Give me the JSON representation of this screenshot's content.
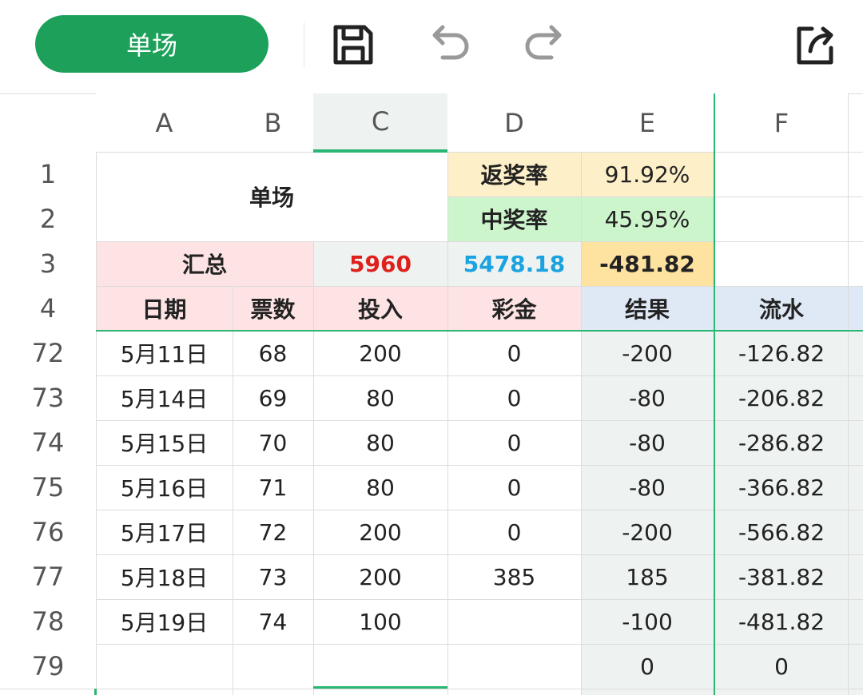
{
  "toolbar": {
    "sheet_name": "单场",
    "icons": [
      "save-icon",
      "undo-icon",
      "redo-icon",
      "share-icon"
    ]
  },
  "columns": [
    "A",
    "B",
    "C",
    "D",
    "E",
    "F"
  ],
  "rows_visible": [
    "1",
    "2",
    "3",
    "4",
    "72",
    "73",
    "74",
    "75",
    "76",
    "77",
    "78",
    "79"
  ],
  "summary": {
    "title": "单场",
    "return_rate_label": "返奖率",
    "return_rate_value": "91.92%",
    "win_rate_label": "中奖率",
    "win_rate_value": "45.95%",
    "total_label": "汇总",
    "total_input": "5960",
    "total_prize": "5478.18",
    "total_result": "-481.82"
  },
  "headers": {
    "date": "日期",
    "tickets": "票数",
    "input": "投入",
    "prize": "彩金",
    "result": "结果",
    "flow": "流水"
  },
  "table_rows": [
    {
      "row": "72",
      "date": "5月11日",
      "tickets": "68",
      "input": "200",
      "prize": "0",
      "result": "-200",
      "flow": "-126.82"
    },
    {
      "row": "73",
      "date": "5月14日",
      "tickets": "69",
      "input": "80",
      "prize": "0",
      "result": "-80",
      "flow": "-206.82"
    },
    {
      "row": "74",
      "date": "5月15日",
      "tickets": "70",
      "input": "80",
      "prize": "0",
      "result": "-80",
      "flow": "-286.82"
    },
    {
      "row": "75",
      "date": "5月16日",
      "tickets": "71",
      "input": "80",
      "prize": "0",
      "result": "-80",
      "flow": "-366.82"
    },
    {
      "row": "76",
      "date": "5月17日",
      "tickets": "72",
      "input": "200",
      "prize": "0",
      "result": "-200",
      "flow": "-566.82"
    },
    {
      "row": "77",
      "date": "5月18日",
      "tickets": "73",
      "input": "200",
      "prize": "385",
      "result": "185",
      "flow": "-381.82"
    },
    {
      "row": "78",
      "date": "5月19日",
      "tickets": "74",
      "input": "100",
      "prize": "",
      "result": "-100",
      "flow": "-481.82"
    },
    {
      "row": "79",
      "date": "",
      "tickets": "",
      "input": "",
      "prize": "",
      "result": "0",
      "flow": "0"
    }
  ],
  "colors": {
    "accent_green": "#1da15a",
    "selection_green": "#2bb673",
    "total_input_red": "#e0201b",
    "total_prize_blue": "#1aa3e0"
  }
}
